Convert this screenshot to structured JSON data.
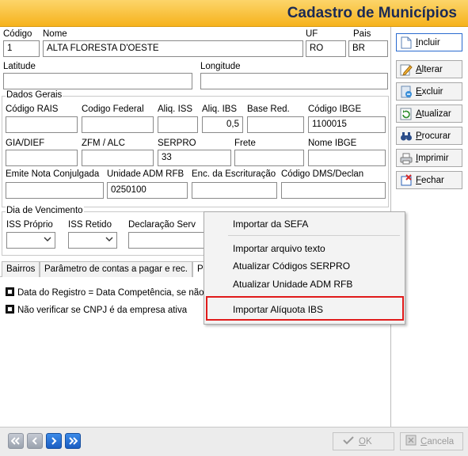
{
  "window": {
    "title": "Cadastro de Municípios"
  },
  "fields": {
    "codigo": {
      "label": "Código",
      "value": "1"
    },
    "nome": {
      "label": "Nome",
      "value": "ALTA FLORESTA D'OESTE"
    },
    "uf": {
      "label": "UF",
      "value": "RO"
    },
    "pais": {
      "label": "Pais",
      "value": "BR"
    },
    "latitude": {
      "label": "Latitude",
      "value": ""
    },
    "longitude": {
      "label": "Longitude",
      "value": ""
    }
  },
  "dados_gerais": {
    "title": "Dados Gerais",
    "codigo_rais": {
      "label": "Código RAIS",
      "value": ""
    },
    "codigo_federal": {
      "label": "Codigo Federal",
      "value": ""
    },
    "aliq_iss": {
      "label": "Aliq. ISS",
      "value": ""
    },
    "aliq_ibs": {
      "label": "Aliq. IBS",
      "value": "0,5"
    },
    "base_red": {
      "label": "Base Red.",
      "value": ""
    },
    "codigo_ibge": {
      "label": "Código IBGE",
      "value": "1100015"
    },
    "gia_dief": {
      "label": "GIA/DIEF",
      "value": ""
    },
    "zfm_alc": {
      "label": "ZFM / ALC",
      "value": ""
    },
    "serpro": {
      "label": "SERPRO",
      "value": "33"
    },
    "frete": {
      "label": "Frete",
      "value": ""
    },
    "nome_ibge": {
      "label": "Nome IBGE",
      "value": ""
    },
    "emite_nota": {
      "label": "Emite Nota Conjulgada",
      "value": ""
    },
    "unidade_adm": {
      "label": "Unidade ADM RFB",
      "value": "0250100"
    },
    "enc_escrituracao": {
      "label": "Enc. da Escrituração",
      "value": ""
    },
    "codigo_dms": {
      "label": "Código DMS/Declan",
      "value": ""
    }
  },
  "dia_vencimento": {
    "title": "Dia de Vencimento",
    "iss_proprio": {
      "label": "ISS Próprio",
      "value": ""
    },
    "iss_retido": {
      "label": "ISS Retido",
      "value": ""
    },
    "declaracao_serv": {
      "label": "Declaração Serv",
      "value": ""
    }
  },
  "tabs": [
    {
      "label": "Bairros"
    },
    {
      "label": "Parâmetro de contas a pagar e rec."
    },
    {
      "label": "P"
    }
  ],
  "checkboxes": [
    {
      "label": "Data do Registro = Data Competência, se não"
    },
    {
      "label": "Não verificar se CNPJ é da empresa ativa"
    }
  ],
  "sidebar": {
    "incluir": {
      "pre": "",
      "ul": "I",
      "post": "ncluir"
    },
    "alterar": {
      "pre": "",
      "ul": "A",
      "post": "lterar"
    },
    "excluir": {
      "pre": "",
      "ul": "E",
      "post": "xcluir"
    },
    "atualizar": {
      "pre": "",
      "ul": "A",
      "post": "tualizar"
    },
    "procurar": {
      "pre": "",
      "ul": "P",
      "post": "rocurar"
    },
    "imprimir": {
      "pre": "",
      "ul": "I",
      "post": "mprimir"
    },
    "fechar": {
      "pre": "",
      "ul": "F",
      "post": "echar"
    }
  },
  "context_menu": {
    "items": [
      "Importar da SEFA",
      "Importar arquivo texto",
      "Atualizar Códigos SERPRO",
      "Atualizar Unidade ADM RFB",
      "Importar Alíquota IBS"
    ],
    "highlight_color": "#e01b1b"
  },
  "bottom": {
    "ok": {
      "ul": "O",
      "post": "K"
    },
    "cancela": {
      "ul": "C",
      "post": "ancela"
    }
  },
  "colors": {
    "title_bar": "#f6b21c",
    "title_text": "#1b2a55",
    "nav_blue": "#1a5dc2"
  }
}
